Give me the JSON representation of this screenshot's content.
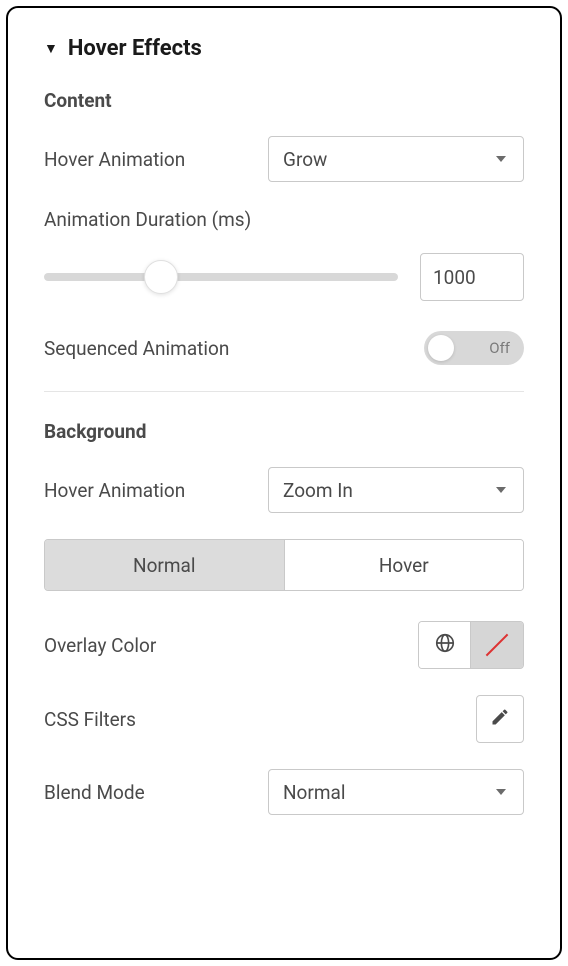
{
  "section_title": "Hover Effects",
  "content": {
    "group_title": "Content",
    "hover_animation_label": "Hover Animation",
    "hover_animation_value": "Grow",
    "duration_label": "Animation Duration (ms)",
    "duration_value": "1000",
    "sequenced_label": "Sequenced Animation",
    "sequenced_state": "Off"
  },
  "background": {
    "group_title": "Background",
    "hover_animation_label": "Hover Animation",
    "hover_animation_value": "Zoom In",
    "tabs": {
      "normal": "Normal",
      "hover": "Hover",
      "active": "normal"
    },
    "overlay_label": "Overlay Color",
    "filters_label": "CSS Filters",
    "blend_label": "Blend Mode",
    "blend_value": "Normal"
  }
}
